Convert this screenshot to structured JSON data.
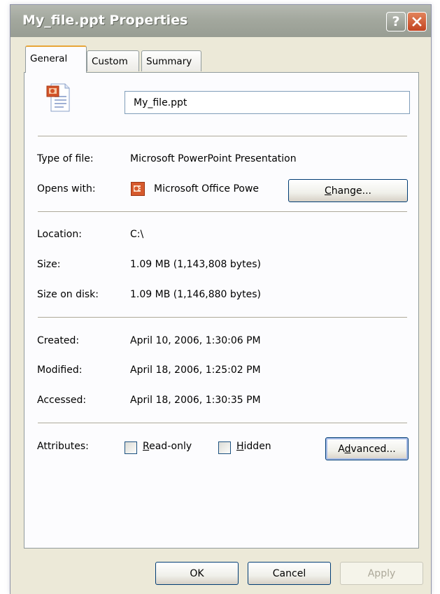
{
  "window": {
    "title": "My_file.ppt Properties",
    "help_label": "?"
  },
  "tabs": [
    {
      "label": "General",
      "active": true
    },
    {
      "label": "Custom",
      "active": false
    },
    {
      "label": "Summary",
      "active": false
    }
  ],
  "general": {
    "file_name": "My_file.ppt",
    "type_label": "Type of file:",
    "type_value": "Microsoft PowerPoint Presentation",
    "opens_label": "Opens with:",
    "opens_value": "Microsoft Office Powe",
    "change_prefix": "",
    "change_mnemonic": "C",
    "change_suffix": "hange...",
    "location_label": "Location:",
    "location_value": "C:\\",
    "size_label": "Size:",
    "size_value": "1.09 MB (1,143,808 bytes)",
    "size_disk_label": "Size on disk:",
    "size_disk_value": "1.09 MB (1,146,880 bytes)",
    "created_label": "Created:",
    "created_value": "April 10, 2006, 1:30:06 PM",
    "modified_label": "Modified:",
    "modified_value": "April 18, 2006, 1:25:02 PM",
    "accessed_label": "Accessed:",
    "accessed_value": "April 18, 2006, 1:30:35 PM",
    "attributes_label": "Attributes:",
    "readonly": {
      "mnemonic": "R",
      "rest": "ead-only",
      "checked": false
    },
    "hidden": {
      "mnemonic": "H",
      "rest": "idden",
      "checked": false
    },
    "advanced": {
      "prefix": "A",
      "mnemonic": "d",
      "suffix": "vanced..."
    }
  },
  "footer": {
    "ok": "OK",
    "cancel": "Cancel",
    "apply": "Apply"
  },
  "colors": {
    "title_bar": "#a3a89e",
    "close_button": "#c24420",
    "tab_highlight": "#e8a538",
    "dialog_bg": "#ECE9D8"
  }
}
